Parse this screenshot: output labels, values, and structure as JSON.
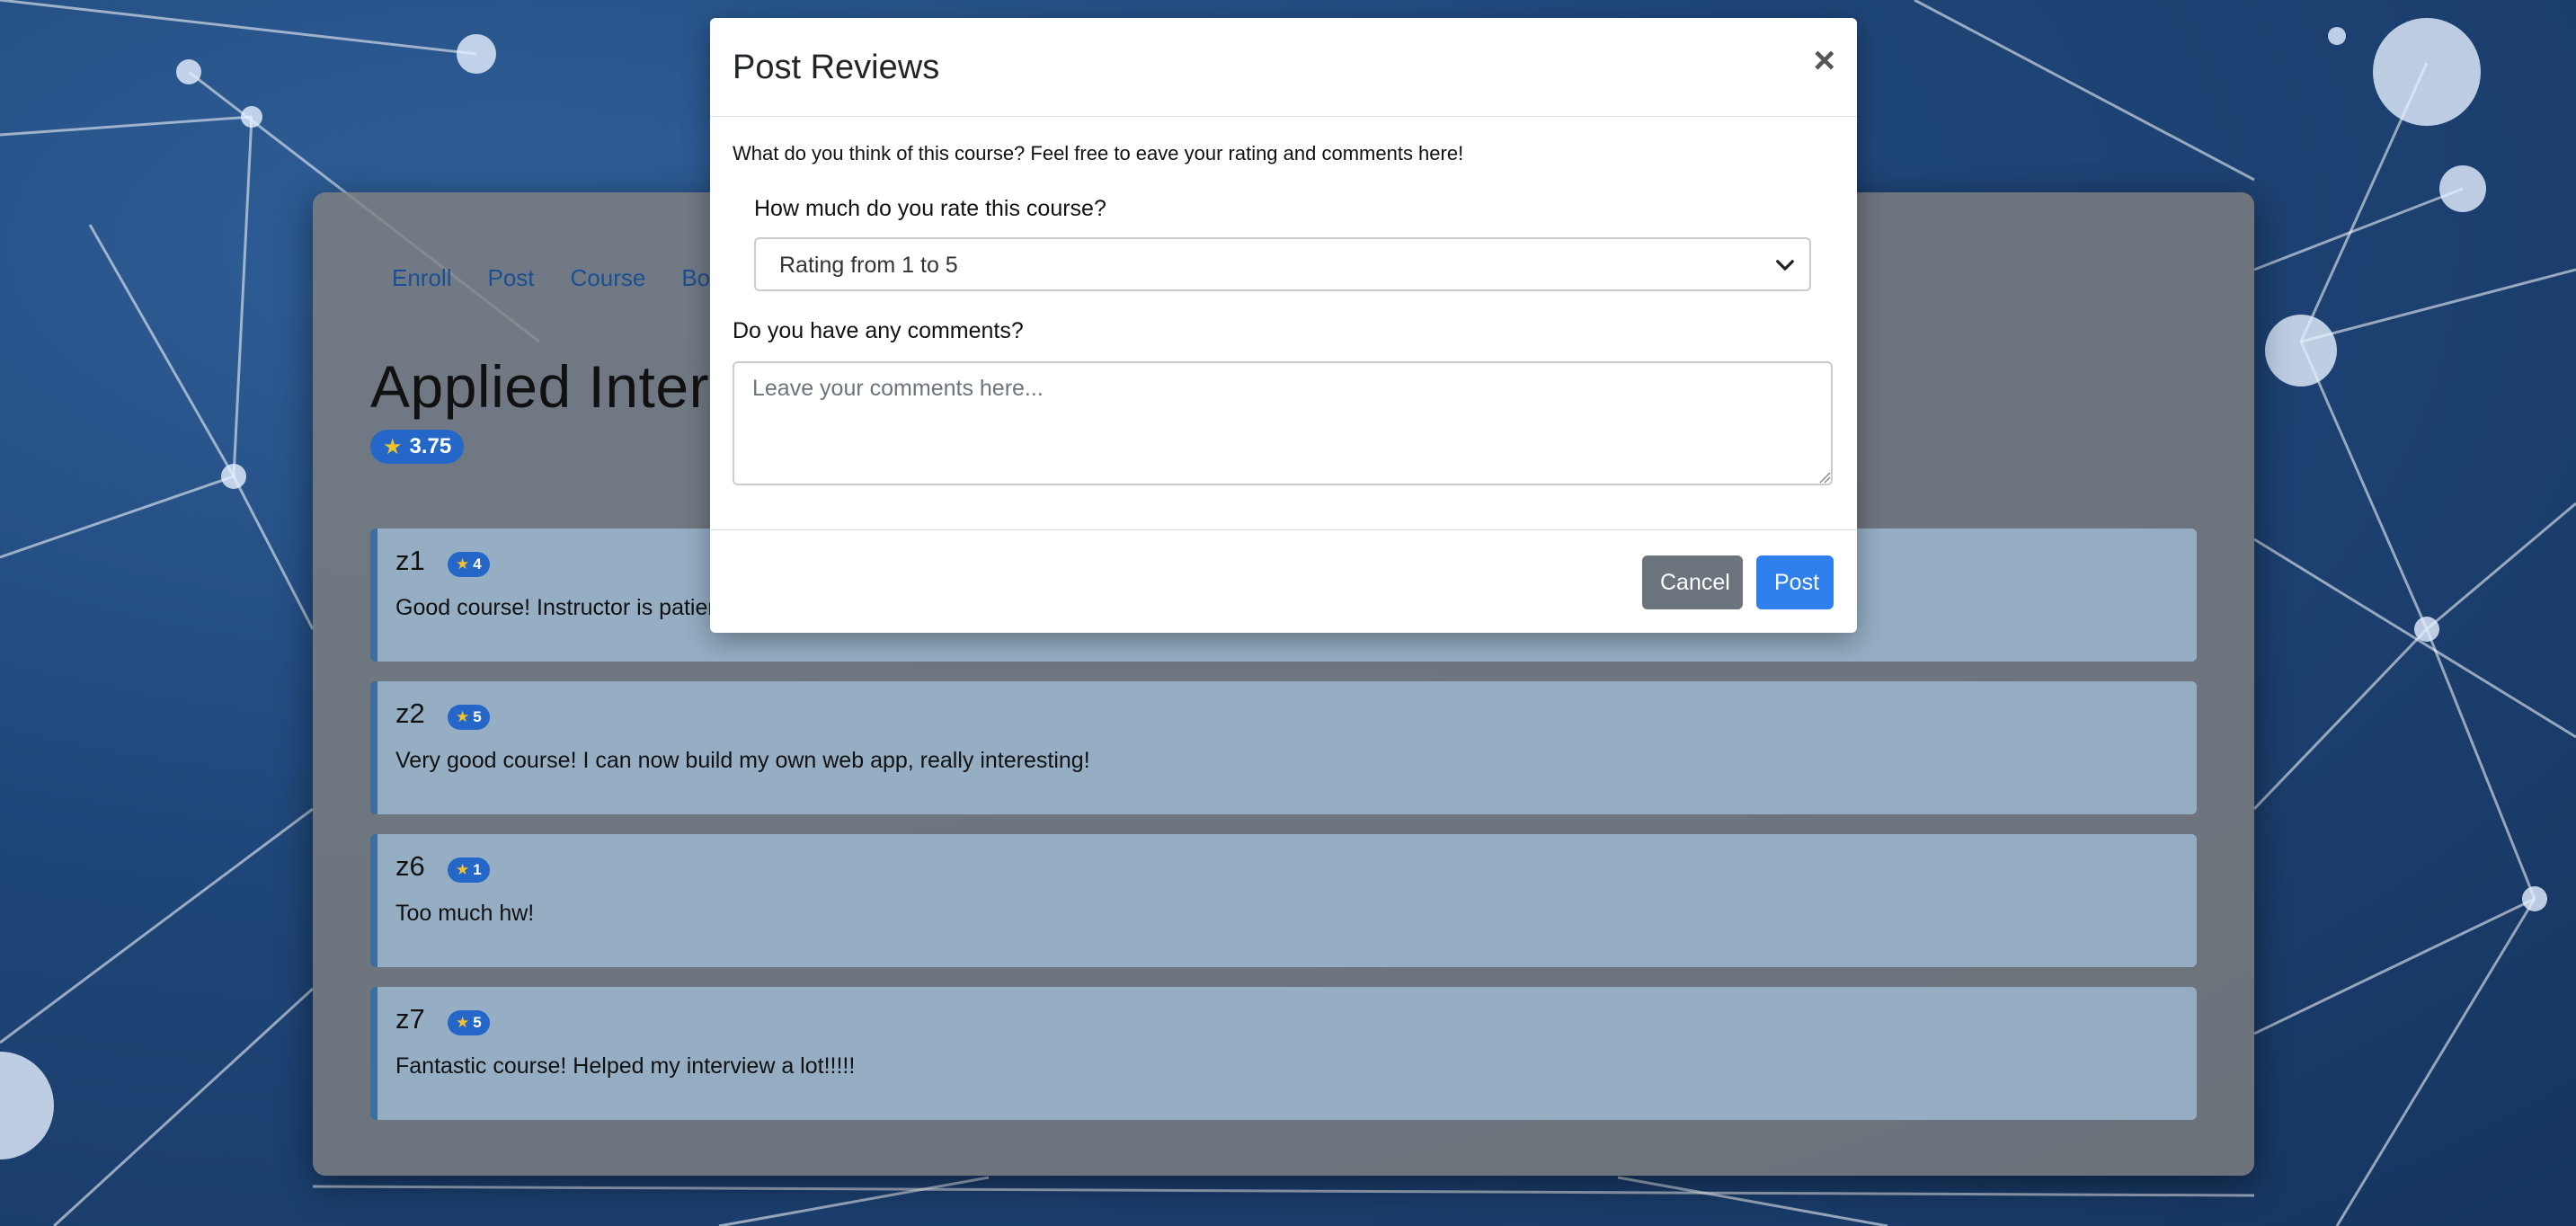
{
  "nav": [
    "Enroll",
    "Post",
    "Course",
    "Bo"
  ],
  "course": {
    "title": "Applied Interne",
    "rating": "3.75",
    "star_icon": "star-icon"
  },
  "reviews": [
    {
      "name": "z1",
      "stars": "4",
      "comment": "Good course! Instructor is patien"
    },
    {
      "name": "z2",
      "stars": "5",
      "comment": "Very good course! I can now build my own web app, really interesting!"
    },
    {
      "name": "z6",
      "stars": "1",
      "comment": "Too much hw!"
    },
    {
      "name": "z7",
      "stars": "5",
      "comment": "Fantastic course! Helped my interview a lot!!!!!"
    }
  ],
  "modal": {
    "title": "Post Reviews",
    "close": "×",
    "intro": "What do you think of this course? Feel free to eave your rating and comments here!",
    "rating_question": "How much do you rate this course?",
    "rating_select_value": "Rating from 1 to 5",
    "comments_question": "Do you have any comments?",
    "comments_placeholder": "Leave your comments here...",
    "cancel_label": "Cancel",
    "post_label": "Post"
  },
  "colors": {
    "primary": "#2f80ed",
    "secondary": "#6c757d",
    "badge": "#2467c9",
    "star": "#f3c22c"
  }
}
